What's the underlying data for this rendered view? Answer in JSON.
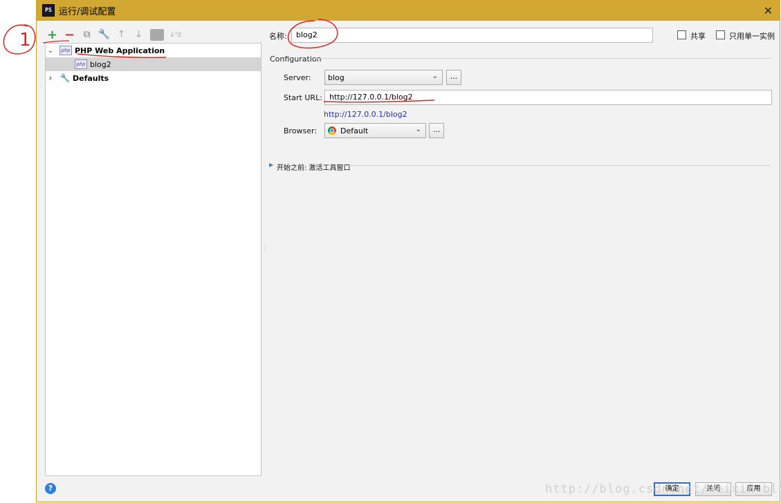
{
  "window": {
    "app_icon_text": "PS",
    "title": "运行/调试配置",
    "close_glyph": "✕"
  },
  "toolbar": {
    "add": "+",
    "remove": "−",
    "copy": "⧉",
    "edit": "🔧",
    "up": "↑",
    "down": "↓",
    "sort": "↓ᵃz"
  },
  "tree": {
    "items": [
      {
        "label": "PHP Web Application",
        "icon": "php-icon",
        "chevron": "⌄"
      },
      {
        "label": "blog2",
        "icon": "php-icon"
      },
      {
        "label": "Defaults",
        "icon": "wrench-icon",
        "chevron": "›"
      }
    ],
    "php_icon_text": "php"
  },
  "form": {
    "name_label": "名称:",
    "name_value": "blog2",
    "share_label": "共享",
    "single_instance_label": "只用单一实例",
    "section_title": "Configuration",
    "server_label": "Server:",
    "server_value": "blog",
    "server_more": "...",
    "start_url_label": "Start URL:",
    "start_url_value": "http://127.0.0.1/blog2",
    "url_preview": "http://127.0.0.1/blog2",
    "browser_label": "Browser:",
    "browser_value": "Default",
    "browser_more": "...",
    "before_launch": "开始之前: 激活工具窗口"
  },
  "footer": {
    "help": "?",
    "ok": "确定",
    "close": "关闭",
    "apply": "应用"
  },
  "watermark": "http://blog.csdn.net/weixin_blog",
  "annotation_number": "1",
  "colors": {
    "titlebar": "#d3a832",
    "annotation": "#e01e1e",
    "link": "#2a2ab8"
  }
}
